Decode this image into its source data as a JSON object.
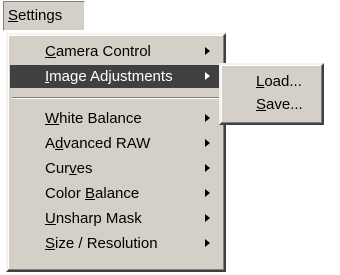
{
  "menubar": {
    "settings_label": "Settings",
    "settings_mnemonic_index": 0
  },
  "menu": {
    "items": [
      {
        "label": "Camera Control",
        "mnemonic_index": 0,
        "has_submenu": true,
        "highlighted": false
      },
      {
        "label": "Image Adjustments",
        "mnemonic_index": 0,
        "has_submenu": true,
        "highlighted": true
      },
      {
        "label": "White Balance",
        "mnemonic_index": 0,
        "has_submenu": true,
        "highlighted": false
      },
      {
        "label": "Advanced RAW",
        "mnemonic_index": 1,
        "has_submenu": true,
        "highlighted": false
      },
      {
        "label": "Curves",
        "mnemonic_index": 3,
        "has_submenu": true,
        "highlighted": false
      },
      {
        "label": "Color Balance",
        "mnemonic_index": 6,
        "has_submenu": true,
        "highlighted": false
      },
      {
        "label": "Unsharp Mask",
        "mnemonic_index": 0,
        "has_submenu": true,
        "highlighted": false
      },
      {
        "label": "Size / Resolution",
        "mnemonic_index": 0,
        "has_submenu": true,
        "highlighted": false
      }
    ]
  },
  "submenu": {
    "items": [
      {
        "label": "Load...",
        "mnemonic_index": 0
      },
      {
        "label": "Save...",
        "mnemonic_index": 0
      }
    ]
  },
  "icons": {
    "submenu_arrow": "chevron-right-icon"
  },
  "colors": {
    "menu_background": "#d4d0c8",
    "highlight_background": "#404040",
    "highlight_text": "#ffffff"
  }
}
